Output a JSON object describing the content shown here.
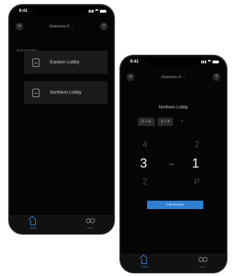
{
  "status": {
    "time": "9:41"
  },
  "header": {
    "title": "Matinkatu 8"
  },
  "list_screen": {
    "section_label": "ELEVATORS",
    "lobbies": [
      {
        "name": "Eastern Lobby"
      },
      {
        "name": "Northern Lobby"
      }
    ]
  },
  "call_screen": {
    "destination_title": "Northern Lobby",
    "chips": [
      "3 + G",
      "3 + 9"
    ],
    "more": "•",
    "floors": {
      "current": "3",
      "target": "1",
      "above_current": "4",
      "below_current": "2",
      "above_target": "2",
      "below_target": "P"
    },
    "arrow": "→",
    "call_button": "Call Elevator"
  },
  "tabbar": {
    "home_label": "Home",
    "users_label": "Users"
  },
  "colors": {
    "accent": "#2f7fd3",
    "background": "#050505",
    "card": "#1b1b1b"
  }
}
